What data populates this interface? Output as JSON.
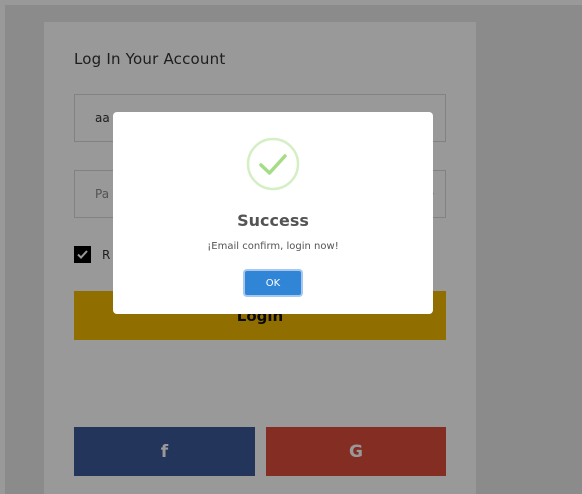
{
  "login_form": {
    "title": "Log In Your Account",
    "email_value": "aa",
    "password_placeholder": "Pa",
    "remember_label": "R",
    "login_label": "Login",
    "facebook_label": "f",
    "google_label": "G"
  },
  "modal": {
    "icon": "checkmark-success-icon",
    "title": "Success",
    "message": "¡Email confirm, login now!",
    "ok_label": "OK"
  },
  "colors": {
    "accent_yellow": "#f0b800",
    "facebook_blue": "#3b5998",
    "google_red": "#dd4b39",
    "success_green": "#a5dc86",
    "ok_blue": "#3085d6"
  }
}
